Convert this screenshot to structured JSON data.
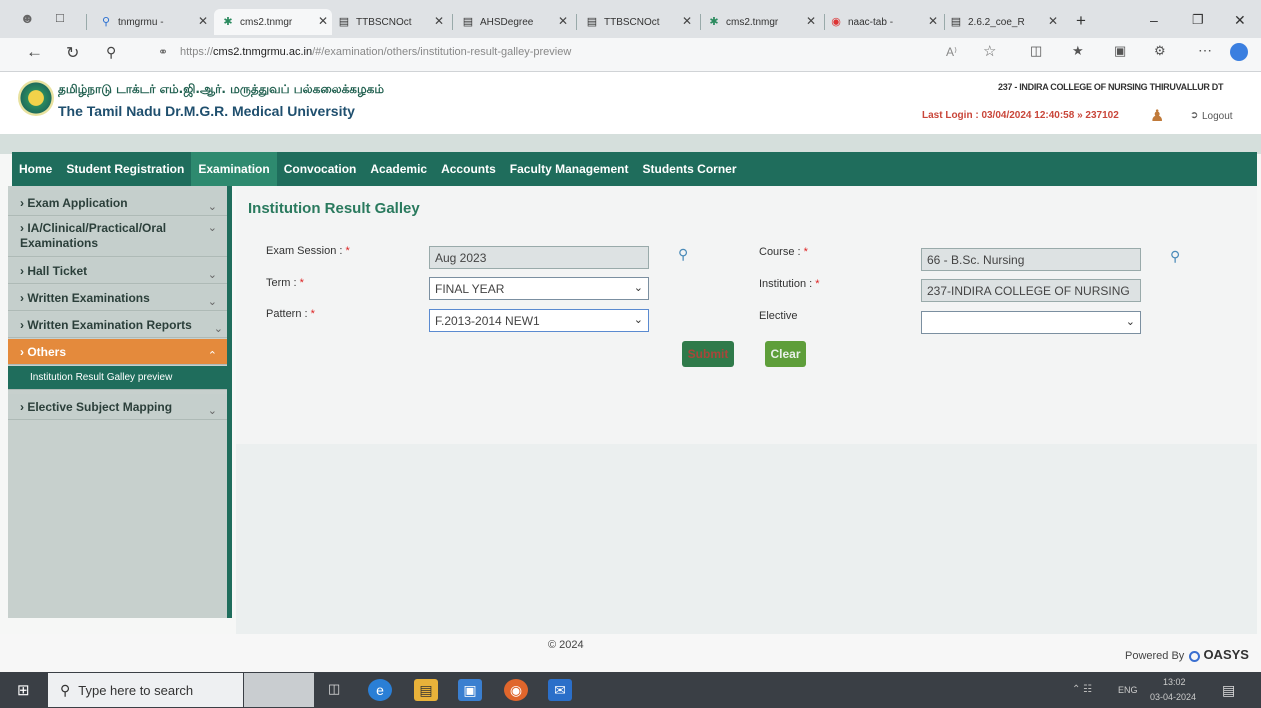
{
  "browser": {
    "tabs": [
      {
        "label": "tnmgrmu - ",
        "icon": "search-icon"
      },
      {
        "label": "cms2.tnmgr",
        "icon": "university-favicon"
      },
      {
        "label": "TTBSCNOct",
        "icon": "document-icon"
      },
      {
        "label": "AHSDegree",
        "icon": "document-icon"
      },
      {
        "label": "TTBSCNOct",
        "icon": "document-icon"
      },
      {
        "label": "cms2.tnmgr",
        "icon": "university-favicon"
      },
      {
        "label": "naac-tab - ",
        "icon": "shield-icon"
      },
      {
        "label": "2.6.2_coe_R",
        "icon": "document-icon"
      }
    ],
    "url_prefix": "https://",
    "url_domain": "cms2.tnmgrmu.ac.in",
    "url_path": "/#/examination/others/institution-result-galley-preview"
  },
  "header": {
    "title_tamil": "தமிழ்நாடு டாக்டர் எம்.ஜி.ஆர். மருத்துவப் பல்கலைக்கழகம்",
    "title_english": "The Tamil Nadu Dr.M.G.R. Medical University",
    "institution": "237 - INDIRA COLLEGE OF NURSING THIRUVALLUR DT",
    "last_login": "Last Login : 03/04/2024 12:40:58 » 237102",
    "logout": "Logout"
  },
  "nav": {
    "items": [
      "Home",
      "Student Registration",
      "Examination",
      "Convocation",
      "Academic",
      "Accounts",
      "Faculty Management",
      "Students Corner"
    ],
    "active": "Examination"
  },
  "sidebar": {
    "items": [
      "Exam Application",
      "IA/Clinical/Practical/Oral Examinations",
      "Hall Ticket",
      "Written Examinations",
      "Written Examination Reports",
      "Others",
      "Institution Result Galley preview",
      "Elective Subject Mapping"
    ]
  },
  "form": {
    "title": "Institution Result Galley",
    "exam_session_label": "Exam Session :",
    "exam_session_value": "Aug 2023",
    "term_label": "Term :",
    "term_value": "FINAL YEAR",
    "pattern_label": "Pattern :",
    "pattern_value": "F.2013-2014 NEW1",
    "course_label": "Course :",
    "course_value": "66 - B.Sc. Nursing",
    "institution_label": "Institution :",
    "institution_value": "237-INDIRA COLLEGE OF NURSING",
    "elective_label": "Elective",
    "elective_value": "",
    "required_mark": "*",
    "submit_label": "Submit",
    "clear_label": "Clear",
    "submit_color": "#2f7a4a",
    "clear_color": "#5e9e3a"
  },
  "footer": {
    "copyright": "© 2024",
    "powered_by": "Powered By",
    "vendor": "OASYS"
  },
  "taskbar": {
    "search_placeholder": "Type here to search",
    "language": "ENG",
    "time": "13:02",
    "date": "03-04-2024"
  },
  "colors": {
    "brand_green": "#1f6d5c",
    "accent_orange": "#e48a3c"
  }
}
